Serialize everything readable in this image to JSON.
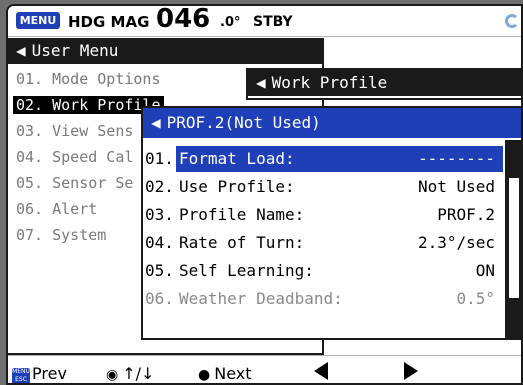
{
  "status": {
    "menu_badge": "MENU",
    "hdg_label": "HDG MAG",
    "hdg_value": "046",
    "hdg_unit": ".0°",
    "mode": "STBY"
  },
  "user_menu": {
    "title": "User Menu",
    "items": [
      {
        "label": "01. Mode Options"
      },
      {
        "label": "02. Work Profile"
      },
      {
        "label": "03. View Sens"
      },
      {
        "label": "04. Speed Cal"
      },
      {
        "label": "05. Sensor Se"
      },
      {
        "label": "06. Alert"
      },
      {
        "label": "07. System"
      }
    ]
  },
  "work_profile": {
    "title": "Work Profile"
  },
  "profile_panel": {
    "title": "PROF.2(Not Used)",
    "rows": [
      {
        "num": "01.",
        "label": "Format Load:",
        "value": "--------"
      },
      {
        "num": "02.",
        "label": "Use Profile:",
        "value": "Not Used"
      },
      {
        "num": "03.",
        "label": "Profile Name:",
        "value": "PROF.2"
      },
      {
        "num": "04.",
        "label": "Rate of Turn:",
        "value": "2.3°/sec"
      },
      {
        "num": "05.",
        "label": "Self Learning:",
        "value": "ON"
      },
      {
        "num": "06.",
        "label": "Weather Deadband:",
        "value": "0.5°"
      }
    ]
  },
  "footer": {
    "prev": "Prev",
    "updown": "↑/↓",
    "next": "Next"
  },
  "colors": {
    "accent": "#1f3fb8",
    "text": "#000000",
    "dim": "#7a7a7a"
  }
}
